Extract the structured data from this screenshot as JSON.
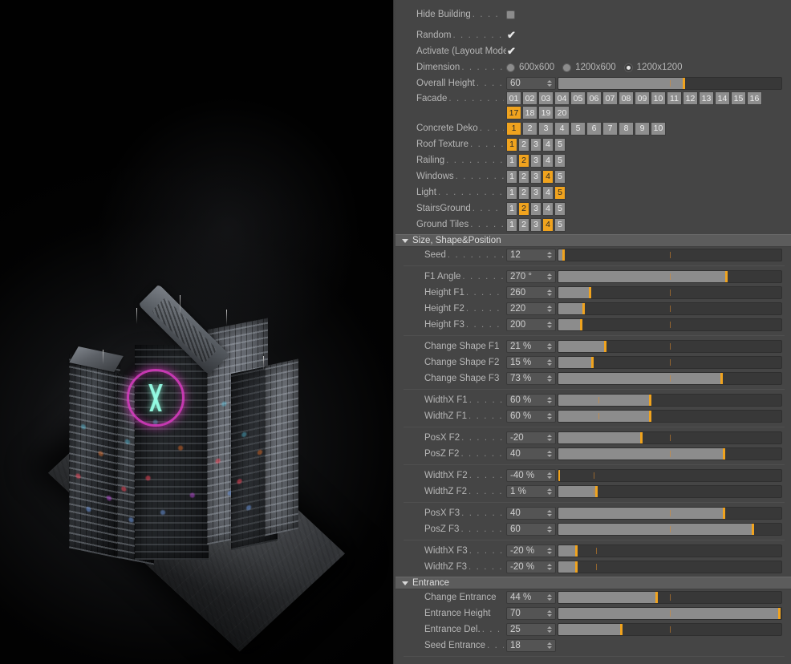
{
  "app": {
    "accent": "#f0a31e",
    "panel_bg": "#454545",
    "viewport_bg": "#010101"
  },
  "viewport": {
    "name": "3d-viewport",
    "subject": "cyberpunk-skyscraper-render"
  },
  "panel": {
    "top_section": {
      "rows": [
        {
          "label": "Hide Building",
          "leader": ". . . . . . . .",
          "type": "checkbox",
          "checked": false
        },
        {
          "label": "Random",
          "leader": ". . . . . . . . . . .",
          "type": "checkbox",
          "checked": true
        },
        {
          "label": "Activate (Layout Mode)",
          "leader": "",
          "type": "checkbox",
          "checked": true
        }
      ],
      "dimension": {
        "label": "Dimension",
        "leader": ". . . . . . . . . .",
        "options": [
          "600x600",
          "1200x600",
          "1200x1200"
        ],
        "selected": "1200x1200"
      },
      "overall_height": {
        "label": "Overall Height",
        "leader": ". . . . . . .",
        "value": "60",
        "fill_pct": 56,
        "knob_pct": 56,
        "tick_pct": 50
      },
      "facade": {
        "label": "Facade",
        "leader": ". . . . . . . . . . . . .",
        "options": [
          "01",
          "02",
          "03",
          "04",
          "05",
          "06",
          "07",
          "08",
          "09",
          "10",
          "11",
          "12",
          "13",
          "14",
          "15",
          "16",
          "17",
          "18",
          "19",
          "20"
        ],
        "selected": "17"
      },
      "toggle_rows": [
        {
          "label": "Concrete Deko",
          "leader": ". . . . . . . .",
          "options": [
            "1",
            "2",
            "3",
            "4",
            "5",
            "6",
            "7",
            "8",
            "9",
            "10"
          ],
          "selected": "1",
          "wide": true
        },
        {
          "label": "Roof Texture",
          "leader": ". . . . . . . . .",
          "options": [
            "1",
            "2",
            "3",
            "4",
            "5"
          ],
          "selected": "1",
          "wide": false
        },
        {
          "label": "Railing",
          "leader": ". . . . . . . . . . . . .",
          "options": [
            "1",
            "2",
            "3",
            "4",
            "5"
          ],
          "selected": "2",
          "wide": false
        },
        {
          "label": "Windows",
          "leader": ". . . . . . . . . . .",
          "options": [
            "1",
            "2",
            "3",
            "4",
            "5"
          ],
          "selected": "4",
          "wide": false
        },
        {
          "label": "Light",
          "leader": ". . . . . . . . . . . . . .",
          "options": [
            "1",
            "2",
            "3",
            "4",
            "5"
          ],
          "selected": "5",
          "wide": false
        },
        {
          "label": "StairsGround",
          "leader": ". . . . . . . .",
          "options": [
            "1",
            "2",
            "3",
            "4",
            "5"
          ],
          "selected": "2",
          "wide": false
        },
        {
          "label": "Ground Tiles",
          "leader": ". . . . . . . .",
          "options": [
            "1",
            "2",
            "3",
            "4",
            "5"
          ],
          "selected": "4",
          "wide": false
        }
      ]
    },
    "size_shape_position": {
      "header": "Size, Shape&Position",
      "groups": [
        {
          "rows": [
            {
              "label": "Seed",
              "leader": ". . . . . . . . . .",
              "value": "12",
              "fill_pct": 2,
              "knob_pct": 2,
              "tick_pct": 50
            }
          ]
        },
        {
          "rows": [
            {
              "label": "F1 Angle",
              "leader": ". . . . . . .",
              "value": "270 °",
              "fill_pct": 75,
              "knob_pct": 75,
              "tick_pct": 50
            },
            {
              "label": "Height F1",
              "leader": ". . . . . .",
              "value": "260",
              "fill_pct": 14,
              "knob_pct": 14,
              "tick_pct": 50
            },
            {
              "label": "Height F2",
              "leader": ". . . . . .",
              "value": "220",
              "fill_pct": 11,
              "knob_pct": 11,
              "tick_pct": 50
            },
            {
              "label": "Height F3",
              "leader": ". . . . . .",
              "value": "200",
              "fill_pct": 10,
              "knob_pct": 10,
              "tick_pct": 50
            }
          ]
        },
        {
          "rows": [
            {
              "label": "Change Shape F1",
              "leader": "",
              "value": "21 %",
              "fill_pct": 21,
              "knob_pct": 21,
              "tick_pct": 50
            },
            {
              "label": "Change Shape F2",
              "leader": "",
              "value": "15 %",
              "fill_pct": 15,
              "knob_pct": 15,
              "tick_pct": 50
            },
            {
              "label": "Change Shape F3",
              "leader": "",
              "value": "73 %",
              "fill_pct": 73,
              "knob_pct": 73,
              "tick_pct": 50
            }
          ]
        },
        {
          "rows": [
            {
              "label": "WidthX F1",
              "leader": ". . . . . .",
              "value": "60 %",
              "fill_pct": 41,
              "knob_pct": 41,
              "tick_pct": 18
            },
            {
              "label": "WidthZ F1",
              "leader": ". . . . . .",
              "value": "60 %",
              "fill_pct": 41,
              "knob_pct": 41,
              "tick_pct": 18
            }
          ]
        },
        {
          "rows": [
            {
              "label": "PosX F2",
              "leader": ". . . . . . . . .",
              "value": "-20",
              "fill_pct": 37,
              "knob_pct": 37,
              "tick_pct": 50
            },
            {
              "label": "PosZ F2",
              "leader": ". . . . . . . . .",
              "value": "40",
              "fill_pct": 74,
              "knob_pct": 74,
              "tick_pct": 50
            }
          ]
        },
        {
          "rows": [
            {
              "label": "WidthX F2",
              "leader": ". . . . . .",
              "value": "-40 %",
              "fill_pct": 0,
              "knob_pct": 0,
              "tick_pct": 16
            },
            {
              "label": "WidthZ F2",
              "leader": ". . . . . .",
              "value": "1 %",
              "fill_pct": 17,
              "knob_pct": 17,
              "tick_pct": 16
            }
          ]
        },
        {
          "rows": [
            {
              "label": "PosX F3",
              "leader": ". . . . . . . . .",
              "value": "40",
              "fill_pct": 74,
              "knob_pct": 74,
              "tick_pct": 50
            },
            {
              "label": "PosZ F3",
              "leader": ". . . . . . . . .",
              "value": "60",
              "fill_pct": 87,
              "knob_pct": 87,
              "tick_pct": 50
            }
          ]
        },
        {
          "rows": [
            {
              "label": "WidthX F3",
              "leader": ". . . . . .",
              "value": "-20 %",
              "fill_pct": 8,
              "knob_pct": 8,
              "tick_pct": 17
            },
            {
              "label": "WidthZ F3",
              "leader": ". . . . . .",
              "value": "-20 %",
              "fill_pct": 8,
              "knob_pct": 8,
              "tick_pct": 17
            }
          ]
        }
      ]
    },
    "entrance": {
      "header": "Entrance",
      "rows": [
        {
          "label": "Change Entrance",
          "leader": "",
          "value": "44 %",
          "fill_pct": 44,
          "knob_pct": 44,
          "tick_pct": 50,
          "slider": true
        },
        {
          "label": "Entrance Height",
          "leader": "",
          "value": "70",
          "fill_pct": 99,
          "knob_pct": 99,
          "tick_pct": 50,
          "slider": true
        },
        {
          "label": "Entrance Del.",
          "leader": ". . . . .",
          "value": "25",
          "fill_pct": 28,
          "knob_pct": 28,
          "tick_pct": 50,
          "slider": true
        },
        {
          "label": "Seed Entrance",
          "leader": ". . .",
          "value": "18",
          "slider": false
        }
      ]
    }
  }
}
